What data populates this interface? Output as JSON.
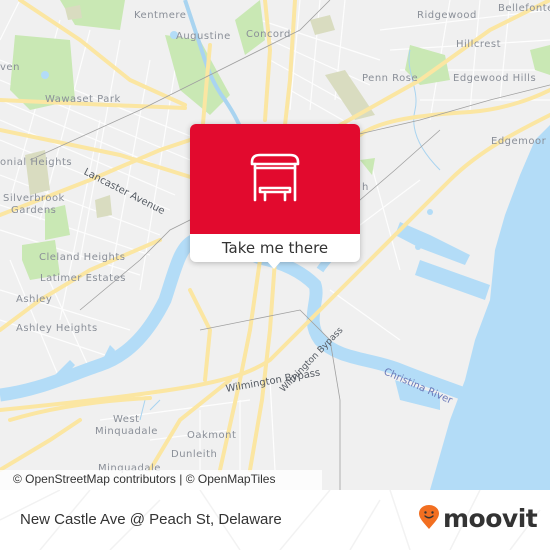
{
  "map": {
    "place_labels": [
      {
        "id": "kentmere",
        "text": "Kentmere"
      },
      {
        "id": "augustine",
        "text": "Augustine"
      },
      {
        "id": "concord",
        "text": "Concord"
      },
      {
        "id": "ridgewood",
        "text": "Ridgewood"
      },
      {
        "id": "bellefonte",
        "text": "Bellefonte"
      },
      {
        "id": "hillcrest",
        "text": "Hillcrest"
      },
      {
        "id": "haven",
        "text": "ven"
      },
      {
        "id": "wawaset-park",
        "text": "Wawaset Park"
      },
      {
        "id": "penn-rose",
        "text": "Penn Rose"
      },
      {
        "id": "edgewood-hills",
        "text": "Edgewood Hills"
      },
      {
        "id": "edgemoor",
        "text": "Edgemoor"
      },
      {
        "id": "colonial-heights",
        "text": "onial Heights"
      },
      {
        "id": "silverbrook-gardens-1",
        "text": "Silverbrook"
      },
      {
        "id": "silverbrook-gardens-2",
        "text": "Gardens"
      },
      {
        "id": "cleland-heights",
        "text": "Cleland Heights"
      },
      {
        "id": "latimer-estates",
        "text": "Latimer Estates"
      },
      {
        "id": "ashley",
        "text": "Ashley"
      },
      {
        "id": "ashley-heights",
        "text": "Ashley Heights"
      },
      {
        "id": "west-minquadale-1",
        "text": "West"
      },
      {
        "id": "west-minquadale-2",
        "text": "Minquadale"
      },
      {
        "id": "oakmont",
        "text": "Oakmont"
      },
      {
        "id": "dunleith",
        "text": "Dunleith"
      },
      {
        "id": "minquadale",
        "text": "Minquadale"
      },
      {
        "id": "partial-h",
        "text": "h"
      }
    ],
    "road_labels": {
      "lancaster_avenue": "Lancaster Avenue",
      "wilmington_bypass": "Wilmington Bypass"
    },
    "water_labels": {
      "christina_river": "Christina River"
    },
    "attribution": "© OpenStreetMap contributors | © OpenMapTiles",
    "colors": {
      "land": "#f0f0f0",
      "water": "#b3dcf7",
      "park": "#c9e8b4",
      "major_road": "#fbe6a2",
      "minor_road": "#ffffff"
    }
  },
  "popup": {
    "icon": "bus-stop-shelter-icon",
    "action_label": "Take me there",
    "header_color": "#e20a2e"
  },
  "footer": {
    "stop_name": "New Castle Ave @ Peach St, Delaware",
    "brand": {
      "name": "moovit",
      "icon": "moovit-pin-icon",
      "pin_color": "#f26f21"
    }
  }
}
